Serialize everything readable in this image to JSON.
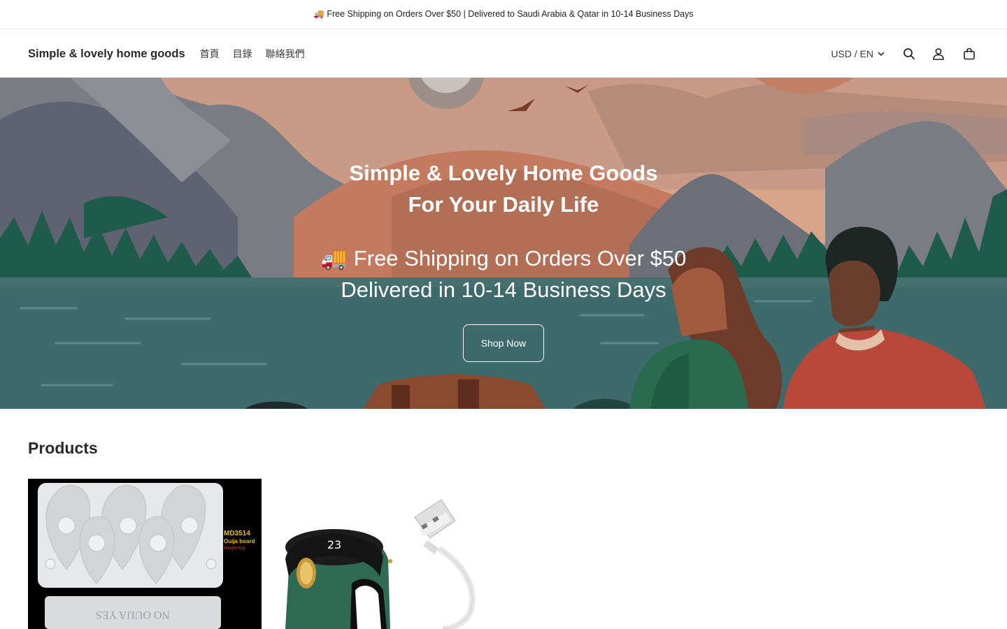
{
  "announcement": {
    "text": "🚚 Free Shipping on Orders Over $50 | Delivered to Saudi Arabia & Qatar in 10-14 Business Days"
  },
  "header": {
    "brand": "Simple & lovely home goods",
    "nav": [
      {
        "label": "首頁"
      },
      {
        "label": "目錄"
      },
      {
        "label": "聯絡我們"
      }
    ],
    "currency_label": "USD / EN",
    "icons": [
      "search-icon",
      "account-icon",
      "cart-icon"
    ]
  },
  "hero": {
    "title_line1": "Simple & Lovely Home Goods",
    "title_line2": "For Your Daily Life",
    "subtitle_line1": "🚚 Free Shipping on Orders Over $50",
    "subtitle_line2": "Delivered in 10-14 Business Days",
    "button_label": "Shop Now"
  },
  "products": {
    "heading": "Products",
    "items": [
      {
        "image_text_code": "MD3514",
        "image_text_name": "Ouija board",
        "image_text_weight": "Weight:82g",
        "board_text": "NO OUIJA YES"
      },
      {
        "image_text_display": "23"
      }
    ]
  },
  "colors": {
    "sky": "#d9a58a",
    "lake": "#3e6a6c",
    "trees": "#1f5b4a",
    "button_border": "#ffffff"
  }
}
